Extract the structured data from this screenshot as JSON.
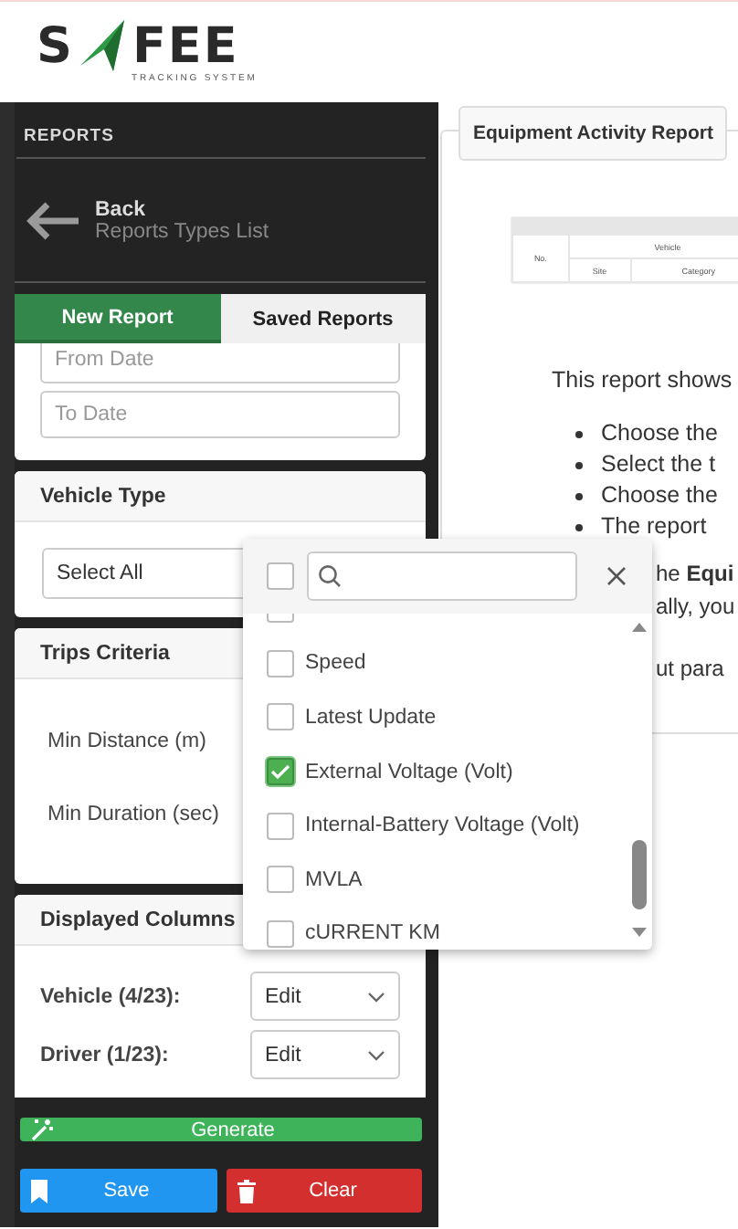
{
  "logo": {
    "left": "S",
    "right": "FEE",
    "tagline": "TRACKING SYSTEM"
  },
  "sidebar": {
    "title": "REPORTS",
    "back": {
      "label": "Back",
      "sublabel": "Reports Types List"
    },
    "tabs": [
      {
        "label": "New Report",
        "selected": true
      },
      {
        "label": "Saved Reports",
        "selected": false
      }
    ],
    "date_fields": [
      {
        "placeholder": "From Date"
      },
      {
        "placeholder": "To Date"
      }
    ],
    "vehicle_type": {
      "title": "Vehicle Type",
      "value": "Select All"
    },
    "trips_criteria": {
      "title": "Trips Criteria",
      "rows": [
        "Min Distance (m)",
        "Min Duration (sec)"
      ]
    },
    "displayed_columns": {
      "title": "Displayed Columns",
      "rows": [
        {
          "label": "Vehicle (4/23):",
          "value": "Edit"
        },
        {
          "label": "Driver (1/23):",
          "value": "Edit"
        }
      ]
    },
    "buttons": [
      {
        "kind": "generate",
        "label": "Generate"
      },
      {
        "kind": "save",
        "label": "Save"
      },
      {
        "kind": "clear",
        "label": "Clear"
      }
    ]
  },
  "main": {
    "tab": "Equipment Activity Report",
    "preview_table": {
      "columns": [
        "No.",
        "Vehicle",
        "Site",
        "Category"
      ]
    },
    "intro": "This report shows",
    "bullets": [
      "Choose the",
      "Select the t",
      "Choose the",
      "The report"
    ],
    "lines": [
      "he **Equi**",
      "ally, you"
    ],
    "after": "ut para"
  },
  "dropdown": {
    "select_all_checked": false,
    "options": [
      {
        "checked": false
      },
      {
        "label": "Speed",
        "checked": false
      },
      {
        "label": "Latest Update",
        "checked": false
      },
      {
        "label": "External Voltage (Volt)",
        "checked": true
      },
      {
        "label": "Internal-Battery Voltage (Volt)",
        "checked": false
      },
      {
        "label": "MVLA",
        "checked": false
      },
      {
        "label": "cURRENT KM",
        "checked": false
      }
    ]
  }
}
